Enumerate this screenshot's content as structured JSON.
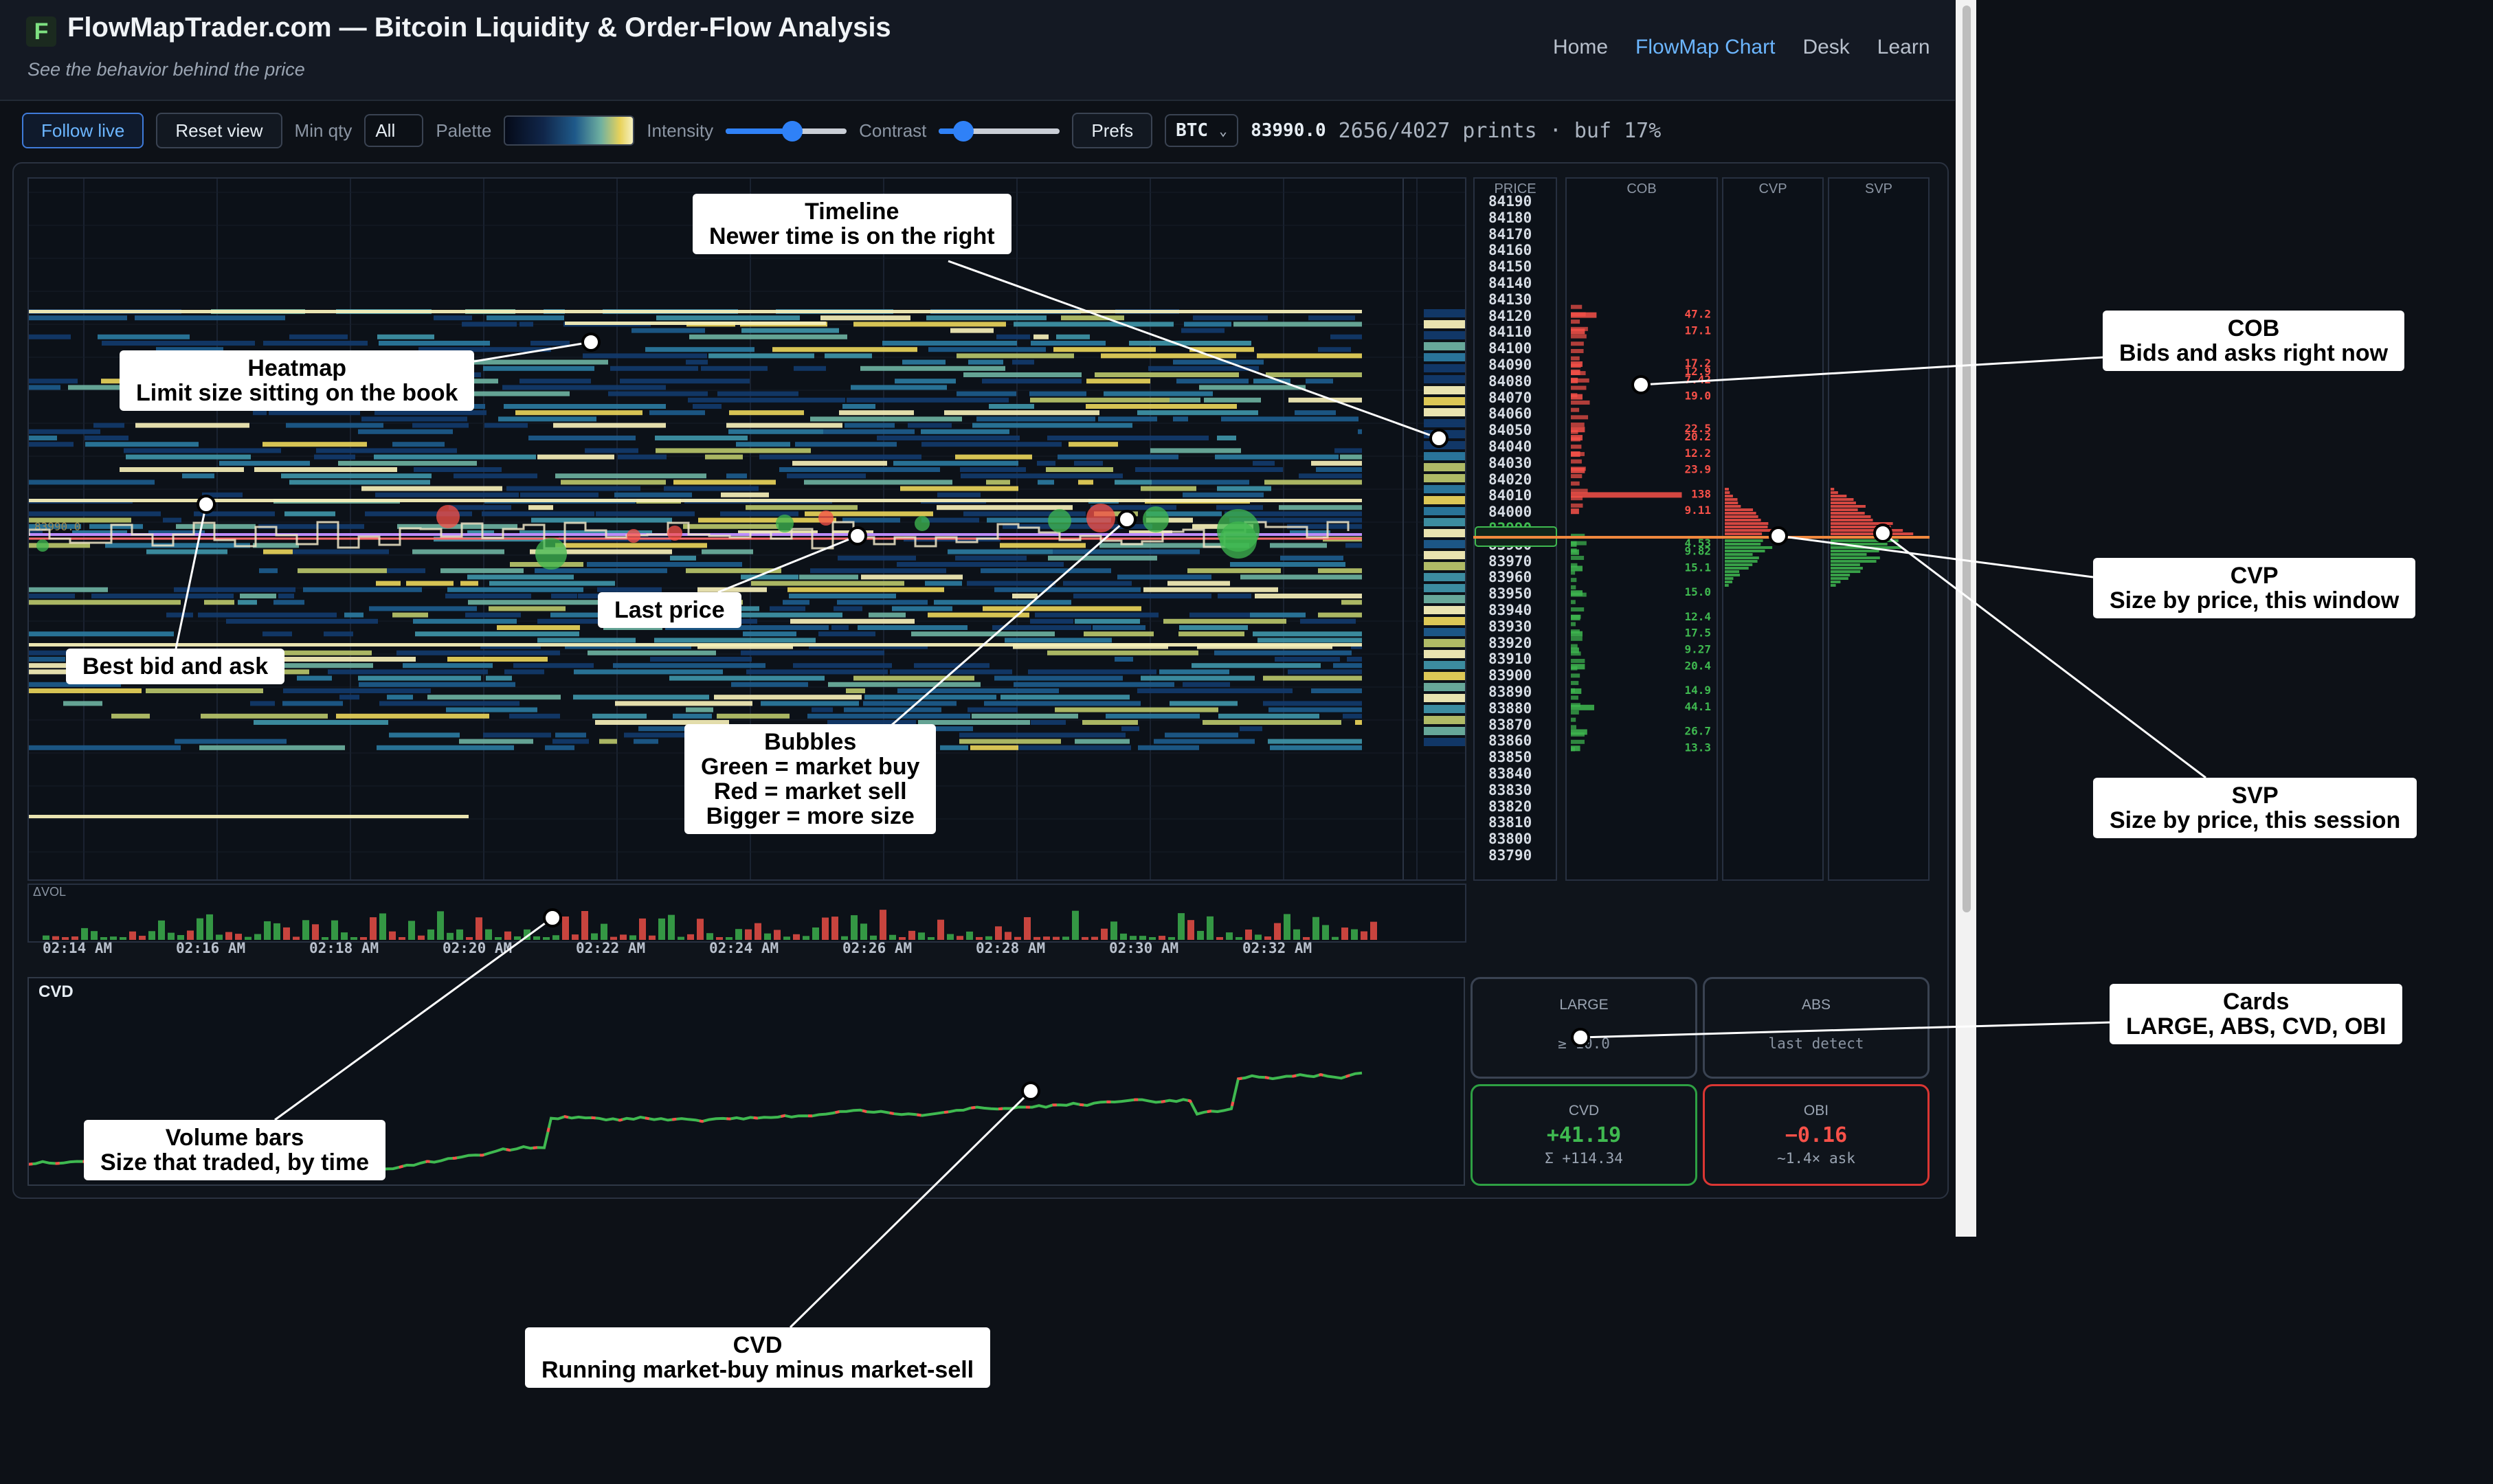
{
  "header": {
    "logo": "F",
    "title": "FlowMapTrader.com — Bitcoin Liquidity & Order-Flow Analysis",
    "tagline": "See the behavior behind the price",
    "nav": [
      {
        "label": "Home",
        "active": false
      },
      {
        "label": "FlowMap Chart",
        "active": true
      },
      {
        "label": "Desk",
        "active": false
      },
      {
        "label": "Learn",
        "active": false
      }
    ]
  },
  "toolbar": {
    "follow_live": "Follow live",
    "reset_view": "Reset view",
    "min_qty_label": "Min qty",
    "min_qty_value": "All",
    "palette_label": "Palette",
    "intensity_label": "Intensity",
    "intensity_value": 0.55,
    "contrast_label": "Contrast",
    "contrast_value": 0.2,
    "prefs": "Prefs",
    "symbol": "BTC",
    "last_price": "83990.0",
    "status": "2656/4027 prints · buf 17%"
  },
  "columns": {
    "price": "PRICE",
    "cob": "COB",
    "cvp": "CVP",
    "svp": "SVP",
    "volume": "ΔVOL",
    "cvd": "CVD"
  },
  "price_ticks": [
    "84190",
    "84180",
    "84170",
    "84160",
    "84150",
    "84140",
    "84130",
    "84120",
    "84110",
    "84100",
    "84090",
    "84080",
    "84070",
    "84060",
    "84050",
    "84040",
    "84030",
    "84020",
    "84010",
    "84000",
    "83990",
    "83980",
    "83970",
    "83960",
    "83950",
    "83940",
    "83930",
    "83920",
    "83910",
    "83900",
    "83890",
    "83880",
    "83870",
    "83860",
    "83850",
    "83840",
    "83830",
    "83820",
    "83810",
    "83800",
    "83790"
  ],
  "time_ticks": [
    "02:14 AM",
    "02:16 AM",
    "02:18 AM",
    "02:20 AM",
    "02:22 AM",
    "02:24 AM",
    "02:26 AM",
    "02:28 AM",
    "02:30 AM",
    "02:32 AM"
  ],
  "best_bid_label": "83990.0",
  "cob_asks": [
    {
      "price": "84120",
      "size": "47.2",
      "frac": 0.22
    },
    {
      "price": "84110",
      "size": "17.1",
      "frac": 0.12
    },
    {
      "price": "84090",
      "size": "17.2",
      "frac": 0.1
    },
    {
      "price": "84085",
      "size": "12.9",
      "frac": 0.08
    },
    {
      "price": "84080",
      "size": "7.42",
      "frac": 0.06
    },
    {
      "price": "84070",
      "size": "19.0",
      "frac": 0.1
    },
    {
      "price": "84050",
      "size": "22.5",
      "frac": 0.12
    },
    {
      "price": "84045",
      "size": "20.2",
      "frac": 0.1
    },
    {
      "price": "84035",
      "size": "12.2",
      "frac": 0.08
    },
    {
      "price": "84025",
      "size": "23.9",
      "frac": 0.12
    },
    {
      "price": "84010",
      "size": "138",
      "frac": 0.95
    },
    {
      "price": "84000",
      "size": "9.11",
      "frac": 0.07
    }
  ],
  "cob_bids": [
    {
      "price": "83980",
      "size": "4.53",
      "frac": 0.05
    },
    {
      "price": "83975",
      "size": "9.82",
      "frac": 0.07
    },
    {
      "price": "83965",
      "size": "15.1",
      "frac": 0.1
    },
    {
      "price": "83950",
      "size": "15.0",
      "frac": 0.1
    },
    {
      "price": "83935",
      "size": "12.4",
      "frac": 0.08
    },
    {
      "price": "83925",
      "size": "17.5",
      "frac": 0.1
    },
    {
      "price": "83915",
      "size": "9.27",
      "frac": 0.07
    },
    {
      "price": "83905",
      "size": "20.4",
      "frac": 0.12
    },
    {
      "price": "83890",
      "size": "14.9",
      "frac": 0.09
    },
    {
      "price": "83880",
      "size": "44.1",
      "frac": 0.2
    },
    {
      "price": "83865",
      "size": "26.7",
      "frac": 0.14
    },
    {
      "price": "83855",
      "size": "13.3",
      "frac": 0.08
    }
  ],
  "cards": {
    "large": {
      "title": "LARGE",
      "sub": "≥ 10.0"
    },
    "abs": {
      "title": "ABS",
      "sub": "last detect"
    },
    "cvd": {
      "title": "CVD",
      "value": "+41.19",
      "sub": "Σ +114.34",
      "color": "#3fb950"
    },
    "obi": {
      "title": "OBI",
      "value": "−0.16",
      "sub": "~1.4× ask",
      "color": "#f85149"
    }
  },
  "annotations": {
    "timeline": [
      "Timeline",
      "Newer time is on the right"
    ],
    "heatmap": [
      "Heatmap",
      "Limit size sitting on the book"
    ],
    "last_price": [
      "Last price"
    ],
    "best_bid_ask": [
      "Best bid and ask"
    ],
    "bubbles": [
      "Bubbles",
      "Green = market buy",
      "Red = market sell",
      "Bigger = more size"
    ],
    "volume_bars": [
      "Volume bars",
      "Size that traded, by time"
    ],
    "cvd": [
      "CVD",
      "Running market-buy minus market-sell"
    ],
    "cob": [
      "COB",
      "Bids and asks right now"
    ],
    "cvp": [
      "CVP",
      "Size by price, this window"
    ],
    "svp": [
      "SVP",
      "Size by price, this session"
    ],
    "cards": [
      "Cards",
      "LARGE, ABS, CVD, OBI"
    ]
  },
  "colors": {
    "buy": "#3fb950",
    "sell": "#f85149",
    "accent": "#6cb6ff",
    "last_price_line": "#f0883e",
    "best_bid_line": "#bc8cff"
  }
}
